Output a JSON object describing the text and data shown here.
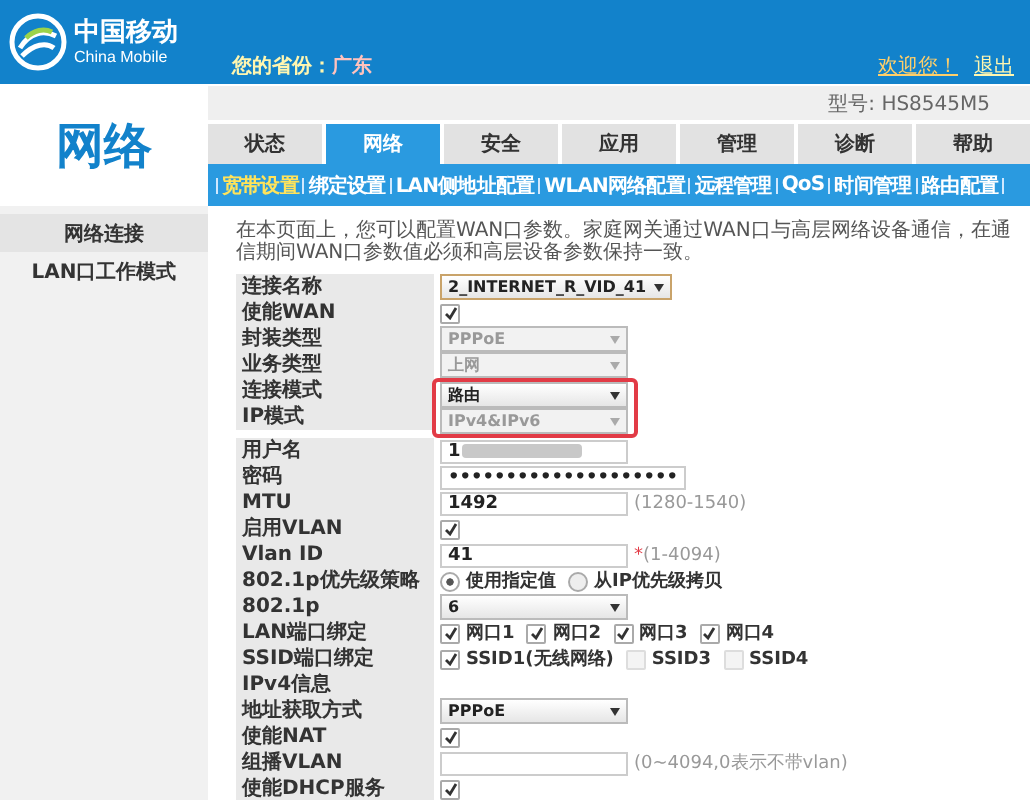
{
  "header": {
    "brand_cn": "中国移动",
    "brand_en": "China Mobile",
    "province_label": "您的省份：",
    "province": "广东",
    "welcome": "欢迎您！",
    "logout": "退出"
  },
  "model": "型号: HS8545M5",
  "page_title": "网络",
  "tabs": [
    {
      "label": "状态",
      "selected": false
    },
    {
      "label": "网络",
      "selected": true
    },
    {
      "label": "安全",
      "selected": false
    },
    {
      "label": "应用",
      "selected": false
    },
    {
      "label": "管理",
      "selected": false
    },
    {
      "label": "诊断",
      "selected": false
    },
    {
      "label": "帮助",
      "selected": false
    }
  ],
  "subnav": [
    {
      "label": "宽带设置",
      "selected": true
    },
    {
      "label": "绑定设置",
      "selected": false
    },
    {
      "label": "LAN侧地址配置",
      "selected": false
    },
    {
      "label": "WLAN网络配置",
      "selected": false
    },
    {
      "label": "远程管理",
      "selected": false
    },
    {
      "label": "QoS",
      "selected": false
    },
    {
      "label": "时间管理",
      "selected": false
    },
    {
      "label": "路由配置",
      "selected": false
    }
  ],
  "sidebar": {
    "items": [
      {
        "label": "网络连接",
        "selected": true
      },
      {
        "label": "LAN口工作模式",
        "selected": false
      }
    ]
  },
  "intro": "在本页面上，您可以配置WAN口参数。家庭网关通过WAN口与高层网络设备通信，在通信期间WAN口参数值必须和高层设备参数保持一致。",
  "form": {
    "rows": [
      {
        "kind": "select",
        "label": "连接名称",
        "value": "2_INTERNET_R_VID_41",
        "disabled": false,
        "focused": true,
        "boxed": false
      },
      {
        "kind": "checkbox",
        "label": "使能WAN",
        "checked": true,
        "boxed": false
      },
      {
        "kind": "select",
        "label": "封装类型",
        "value": "PPPoE",
        "disabled": true,
        "focused": false,
        "boxed": false
      },
      {
        "kind": "select",
        "label": "业务类型",
        "value": "上网",
        "disabled": true,
        "focused": false,
        "boxed": false
      },
      {
        "kind": "select",
        "label": "连接模式",
        "value": "路由",
        "disabled": false,
        "focused": false,
        "boxed": true
      },
      {
        "kind": "select",
        "label": "IP模式",
        "value": "IPv4&IPv6",
        "disabled": true,
        "focused": false,
        "boxed": true
      },
      {
        "kind": "text",
        "label": "用户名",
        "value": "1",
        "redacted": true,
        "boxed": false
      },
      {
        "kind": "password",
        "label": "密码",
        "value": "••••••••••••••••••••",
        "boxed": false
      },
      {
        "kind": "text",
        "label": "MTU",
        "value": "1492",
        "hint": "(1280-1540)",
        "boxed": false
      },
      {
        "kind": "checkbox",
        "label": "启用VLAN",
        "checked": true,
        "boxed": false
      },
      {
        "kind": "text",
        "label": "Vlan ID",
        "value": "41",
        "required_mark": "*",
        "hint": "(1-4094)",
        "boxed": false
      },
      {
        "kind": "radio",
        "label": "802.1p优先级策略",
        "options": [
          {
            "label": "使用指定值",
            "selected": true
          },
          {
            "label": "从IP优先级拷贝",
            "selected": false
          }
        ],
        "boxed": false
      },
      {
        "kind": "select",
        "label": "802.1p",
        "value": "6",
        "disabled": false,
        "focused": false,
        "boxed": false
      },
      {
        "kind": "checkgroup",
        "label": "LAN端口绑定",
        "options": [
          {
            "label": "网口1",
            "checked": true
          },
          {
            "label": "网口2",
            "checked": true
          },
          {
            "label": "网口3",
            "checked": true
          },
          {
            "label": "网口4",
            "checked": true
          }
        ],
        "boxed": false
      },
      {
        "kind": "checkgroup",
        "label": "SSID端口绑定",
        "options": [
          {
            "label": "SSID1(无线网络)",
            "checked": true
          },
          {
            "label": "SSID3",
            "checked": false
          },
          {
            "label": "SSID4",
            "checked": false
          }
        ],
        "boxed": false
      },
      {
        "kind": "section",
        "label": "IPv4信息",
        "boxed": false
      },
      {
        "kind": "select",
        "label": "地址获取方式",
        "value": "PPPoE",
        "disabled": false,
        "focused": false,
        "boxed": false
      },
      {
        "kind": "checkbox",
        "label": "使能NAT",
        "checked": true,
        "boxed": false
      },
      {
        "kind": "text",
        "label": "组播VLAN",
        "value": "",
        "hint": "(0~4094,0表示不带vlan)",
        "boxed": false
      },
      {
        "kind": "checkbox",
        "label": "使能DHCP服务",
        "checked": true,
        "boxed": false
      }
    ]
  }
}
